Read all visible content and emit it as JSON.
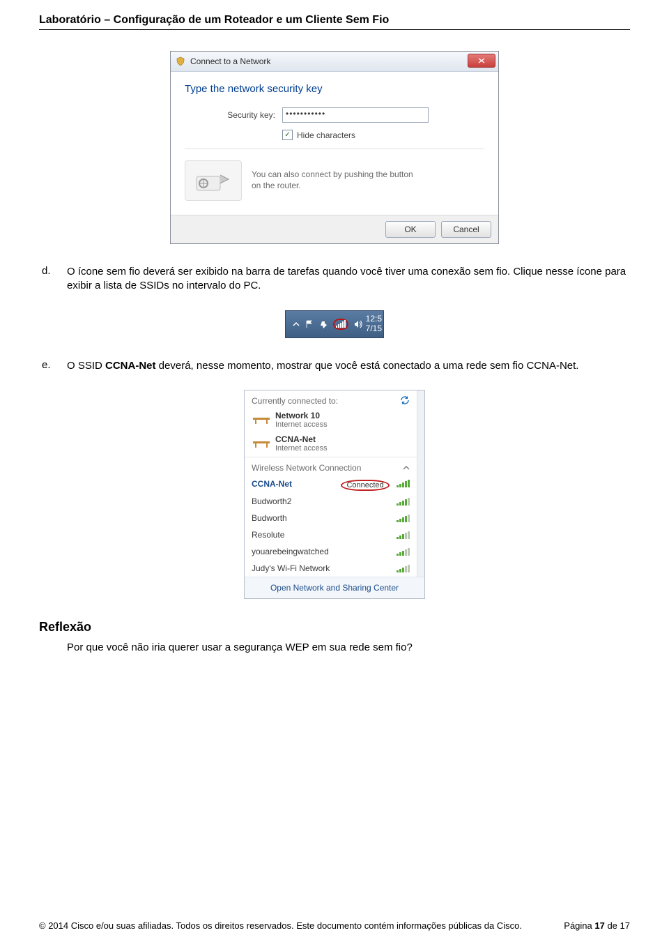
{
  "header": {
    "title": "Laboratório – Configuração de um Roteador e um Cliente Sem Fio"
  },
  "dialog": {
    "window_title": "Connect to a Network",
    "instruction": "Type the network security key",
    "security_key_label": "Security key:",
    "security_key_value": "•••••••••••",
    "hide_chars_label": "Hide characters",
    "hide_chars_checked": "✓",
    "hint_text": "You can also connect by pushing the button on the router.",
    "ok_button": "OK",
    "cancel_button": "Cancel"
  },
  "step_d": {
    "marker": "d.",
    "text_a": "O ícone sem fio deverá ser exibido na barra de tarefas quando você tiver uma conexão sem fio. Clique nesse ícone para exibir a lista de SSIDs no intervalo do PC."
  },
  "tray": {
    "time": "12:5",
    "date": "7/15",
    "icons": [
      "chevron-up",
      "flag",
      "power",
      "network",
      "volume"
    ]
  },
  "step_e": {
    "marker": "e.",
    "text_prefix": "O SSID ",
    "ssid_bold": "CCNA-Net",
    "text_suffix": " deverá, nesse momento, mostrar que você está conectado a uma rede sem fio CCNA-Net."
  },
  "flyout": {
    "header_text": "Currently connected to:",
    "connected": [
      {
        "name": "Network 10",
        "subtitle": "Internet access"
      },
      {
        "name": "CCNA-Net",
        "subtitle": "Internet access"
      }
    ],
    "section_title": "Wireless Network Connection",
    "networks": [
      {
        "name": "CCNA-Net",
        "status": "Connected",
        "strength": 5,
        "connected": true
      },
      {
        "name": "Budworth2",
        "strength": 4
      },
      {
        "name": "Budworth",
        "strength": 4
      },
      {
        "name": "Resolute",
        "strength": 3
      },
      {
        "name": "youarebeingwatched",
        "strength": 3
      },
      {
        "name": "Judy's Wi-Fi Network",
        "strength": 3
      }
    ],
    "footer_link": "Open Network and Sharing Center"
  },
  "reflexao": {
    "title": "Reflexão",
    "question": "Por que você não iria querer usar a segurança WEP em sua rede sem fio?"
  },
  "footer": {
    "left": "© 2014 Cisco e/ou suas afiliadas. Todos os direitos reservados. Este documento contém informações públicas da Cisco.",
    "right": "Página 17 de 17"
  }
}
